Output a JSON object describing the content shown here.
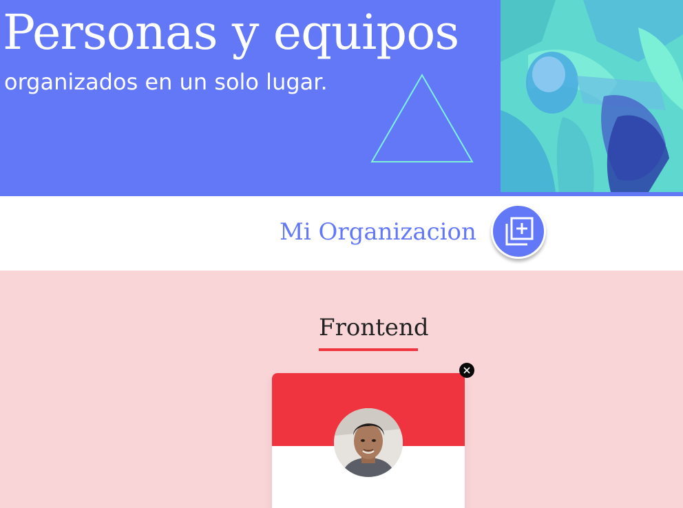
{
  "banner": {
    "title": "Personas y equipos",
    "subtitle": "organizados en un solo lugar."
  },
  "organization": {
    "title": "Mi Organizacion",
    "add_button_icon": "add-copy-icon"
  },
  "teams": [
    {
      "title": "Frontend",
      "color_primary": "#ef3440",
      "color_background": "#f9d5d8",
      "members": [
        {
          "avatar_icon": "person-photo"
        }
      ]
    }
  ],
  "colors": {
    "brand": "#6278f7",
    "accent": "#5fd9cf",
    "white": "#ffffff"
  }
}
